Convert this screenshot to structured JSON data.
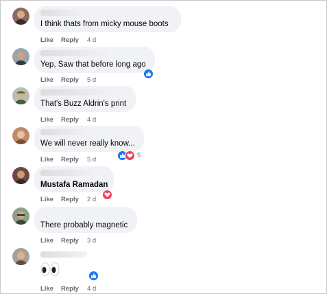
{
  "comments": [
    {
      "name": "",
      "text": "I think thats from micky mouse boots",
      "actions": {
        "like": "Like",
        "reply": "Reply",
        "time": "4 d"
      }
    },
    {
      "name": "",
      "text": "Yep, Saw that before long ago",
      "actions": {
        "like": "Like",
        "reply": "Reply",
        "time": "5 d"
      },
      "reactions": {
        "icons": [
          "like"
        ]
      }
    },
    {
      "name": "",
      "text": "That's Buzz Aldrin's print",
      "actions": {
        "like": "Like",
        "reply": "Reply",
        "time": "4 d"
      }
    },
    {
      "name": "",
      "text": "We will never really know...",
      "actions": {
        "like": "Like",
        "reply": "Reply",
        "time": "5 d"
      },
      "reactions": {
        "icons": [
          "like",
          "love"
        ],
        "count": "5"
      }
    },
    {
      "name": "Mustafa Ramadan",
      "text": "",
      "actions": {
        "like": "Like",
        "reply": "Reply",
        "time": "2 d"
      },
      "reactions": {
        "icons": [
          "love"
        ]
      }
    },
    {
      "name": "",
      "text": "There probably magnetic",
      "actions": {
        "like": "Like",
        "reply": "Reply",
        "time": "3 d"
      }
    },
    {
      "name": "",
      "text": "",
      "emoji": "eyes",
      "actions": {
        "like": "Like",
        "reply": "Reply",
        "time": "4 d"
      },
      "reactions": {
        "icons": [
          "like"
        ]
      }
    }
  ],
  "colors": {
    "bubble": "#f0f2f5",
    "like": "#1877f2",
    "love": "#f33e58",
    "meta": "#65676b"
  }
}
